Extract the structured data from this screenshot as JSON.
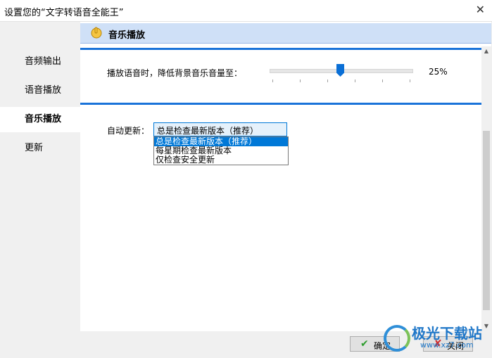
{
  "window": {
    "title": "设置您的“文字转语音全能王”",
    "close_glyph": "✕"
  },
  "sidebar": {
    "items": [
      {
        "label": "音频输出",
        "active": false
      },
      {
        "label": "语音播放",
        "active": false
      },
      {
        "label": "音乐播放",
        "active": true
      },
      {
        "label": "更新",
        "active": false
      }
    ]
  },
  "header": {
    "title": "音乐播放",
    "icon": "music-hand-icon",
    "color": "#cfe0f7"
  },
  "music": {
    "label": "播放语音时，降低背景音乐音量至：",
    "volume_percent": 25,
    "volume_text": "25%"
  },
  "update": {
    "label": "自动更新：",
    "selected": "总是检查最新版本（推荐）",
    "options": [
      "总是检查最新版本（推荐）",
      "每星期检查最新版本",
      "仅检查安全更新"
    ]
  },
  "buttons": {
    "ok": "确定",
    "cancel": "关闭"
  },
  "watermark": {
    "text": "极光下载站",
    "url": "www.xz7.com"
  },
  "colors": {
    "accent": "#1a73d9",
    "selection": "#0078d7"
  }
}
